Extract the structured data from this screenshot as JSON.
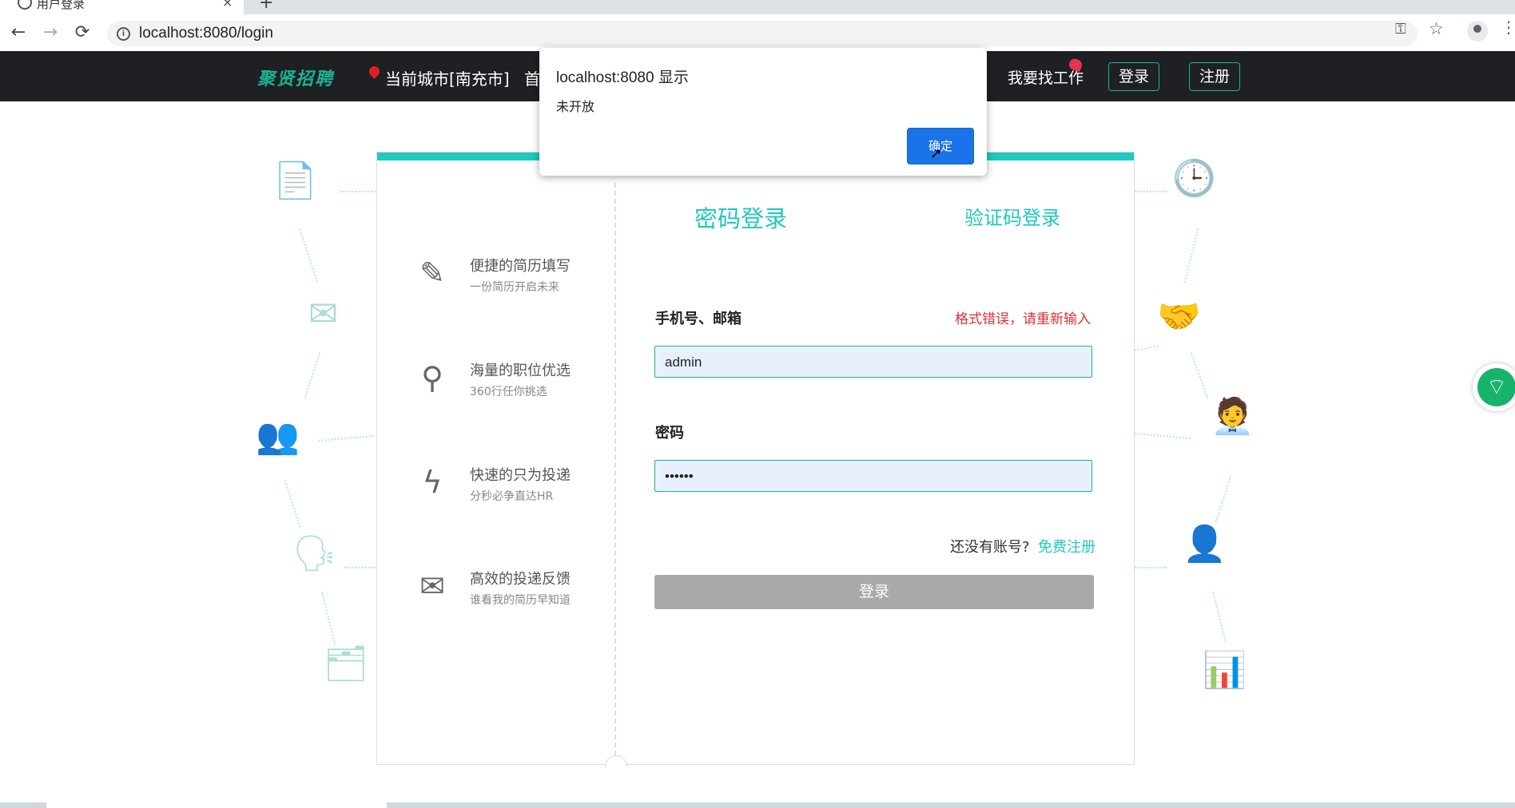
{
  "browser": {
    "tab_title": "用户登录",
    "url": "localhost:8080/login",
    "back_icon": "←",
    "forward_icon": "→",
    "reload_icon": "⟳",
    "new_tab_icon": "+",
    "close_tab_icon": "×"
  },
  "header": {
    "logo": "聚贤招聘",
    "city": "当前城市[南充市]",
    "nav_home": "首",
    "nav_find_job": "我要找工作",
    "login_label": "登录",
    "register_label": "注册"
  },
  "features": [
    {
      "title": "便捷的简历填写",
      "subtitle": "一份简历开启未来",
      "icon": "pencil-icon"
    },
    {
      "title": "海量的职位优选",
      "subtitle": "360行任你挑选",
      "icon": "search-icon"
    },
    {
      "title": "快速的只为投递",
      "subtitle": "分秒必争直达HR",
      "icon": "lightning-icon"
    },
    {
      "title": "高效的投递反馈",
      "subtitle": "谁看我的简历早知道",
      "icon": "mail-icon"
    }
  ],
  "login": {
    "tab_password": "密码登录",
    "tab_code": "验证码登录",
    "account_label": "手机号、邮箱",
    "error_text": "格式错误，请重新输入",
    "account_value": "admin",
    "password_label": "密码",
    "password_value": "••••••",
    "no_account": "还没有账号?",
    "free_register": "免费注册",
    "submit_label": "登录"
  },
  "dialog": {
    "title": "localhost:8080 显示",
    "message": "未开放",
    "ok_label": "确定"
  },
  "colors": {
    "accent": "#1fc8c0",
    "header_bg": "#1f2023",
    "error": "#d9323a",
    "dialog_button": "#1a73e8"
  }
}
